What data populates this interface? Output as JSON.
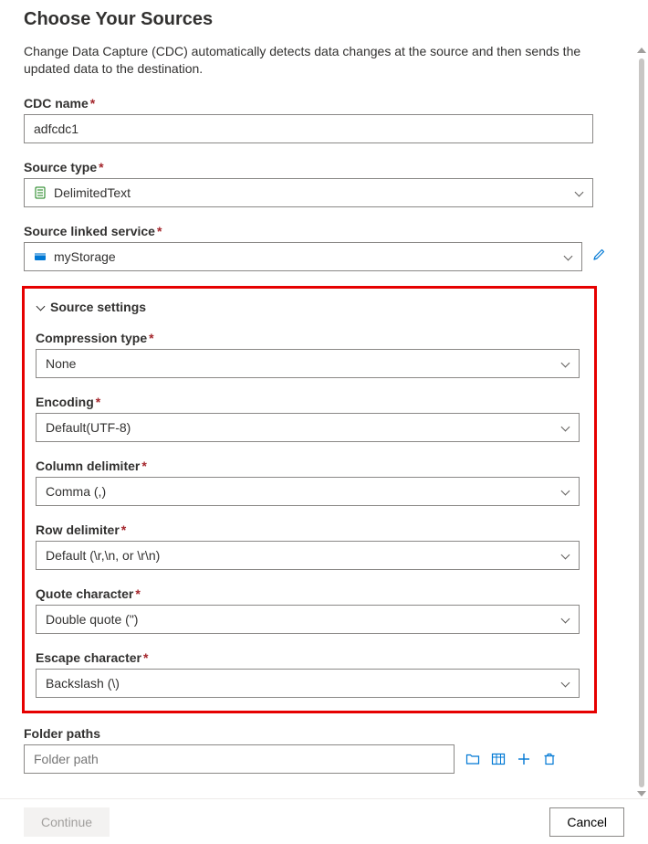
{
  "header": {
    "title": "Choose Your Sources",
    "subtitle": "Change Data Capture (CDC) automatically detects data changes at the source and then sends the updated data to the destination."
  },
  "fields": {
    "cdc_name": {
      "label": "CDC name",
      "value": "adfcdc1"
    },
    "source_type": {
      "label": "Source type",
      "value": "DelimitedText",
      "icon": "file-icon"
    },
    "source_linked_service": {
      "label": "Source linked service",
      "value": "myStorage",
      "icon": "storage-icon"
    }
  },
  "source_settings": {
    "section_title": "Source settings",
    "compression_type": {
      "label": "Compression type",
      "value": "None"
    },
    "encoding": {
      "label": "Encoding",
      "value": "Default(UTF-8)"
    },
    "column_delimiter": {
      "label": "Column delimiter",
      "value": "Comma (,)"
    },
    "row_delimiter": {
      "label": "Row delimiter",
      "value": "Default (\\r,\\n, or \\r\\n)"
    },
    "quote_character": {
      "label": "Quote character",
      "value": "Double quote (\")"
    },
    "escape_character": {
      "label": "Escape character",
      "value": "Backslash (\\)"
    }
  },
  "folder_paths": {
    "label": "Folder paths",
    "placeholder": "Folder path"
  },
  "footer": {
    "continue_label": "Continue",
    "cancel_label": "Cancel"
  }
}
